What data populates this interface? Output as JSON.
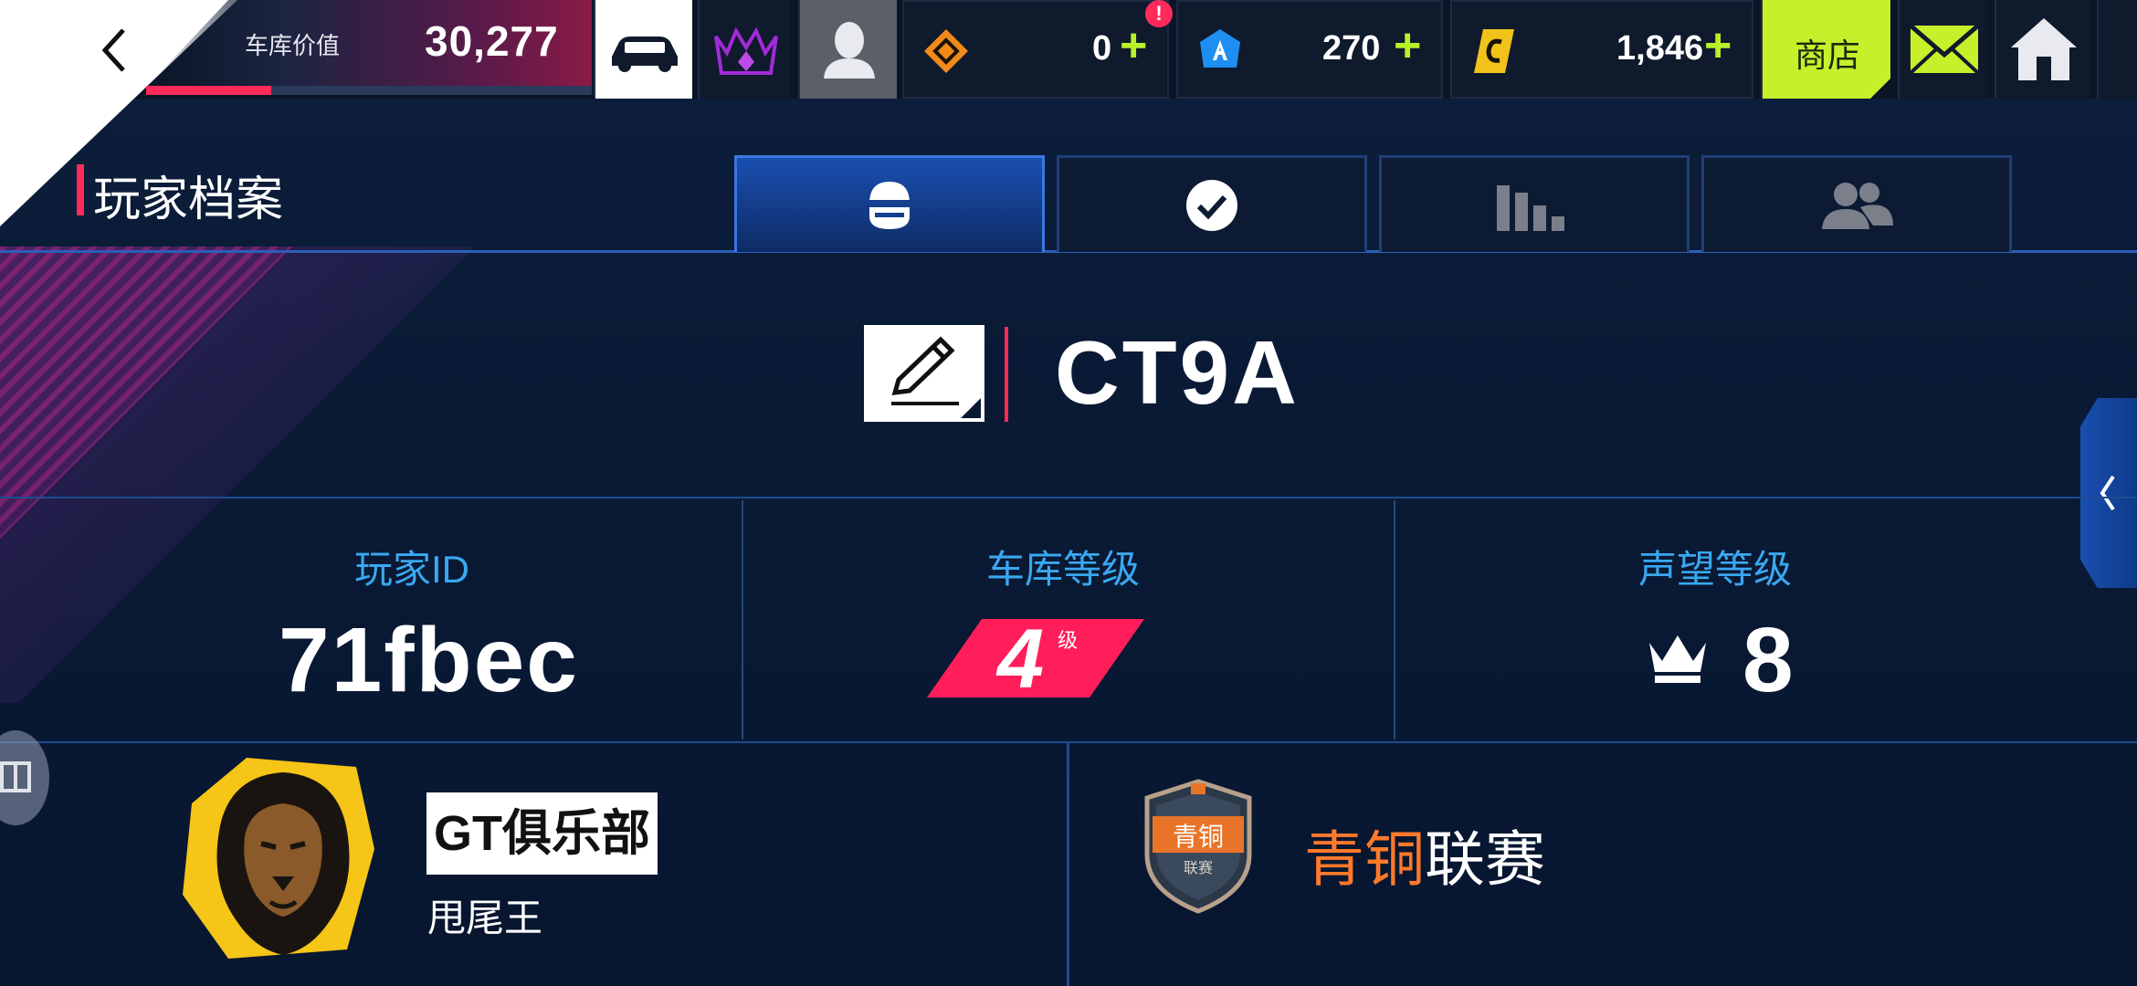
{
  "topbar": {
    "garage_value_label": "车库价值",
    "garage_value": "30,277",
    "garage_progress": 0.28,
    "currencies": [
      {
        "name": "token-icon",
        "value": "0",
        "color": "#f08a1a"
      },
      {
        "name": "gem-icon",
        "value": "270",
        "color": "#1e8ff0"
      },
      {
        "name": "credit-icon",
        "value": "1,846",
        "color": "#f0c21a"
      }
    ],
    "plus_label": "+",
    "alert_badge": "!",
    "shop_label": "商店"
  },
  "page": {
    "title": "玩家档案"
  },
  "tabs": [
    {
      "name": "profile-tab",
      "icon": "helmet-icon",
      "active": true
    },
    {
      "name": "achievements-tab",
      "icon": "checkmark-icon",
      "active": false
    },
    {
      "name": "stats-tab",
      "icon": "bar-chart-icon",
      "active": false
    },
    {
      "name": "friends-tab",
      "icon": "friends-icon",
      "active": false
    }
  ],
  "player": {
    "name": "CT9A",
    "stats": {
      "id_label": "玩家ID",
      "id_value": "71fbec",
      "garage_level_label": "车库等级",
      "garage_level_value": "4",
      "garage_level_unit": "级",
      "reputation_label": "声望等级",
      "reputation_value": "8"
    }
  },
  "club": {
    "name": "GT俱乐部",
    "member_title": "甩尾王"
  },
  "league": {
    "tier": "青铜",
    "suffix": "联赛",
    "badge_text": "青铜",
    "badge_sub": "联赛"
  },
  "colors": {
    "accent_pink": "#ff2a5a",
    "accent_lime": "#c8f02a",
    "label_blue": "#3aa8f0",
    "tier_orange": "#ff7a2a"
  }
}
